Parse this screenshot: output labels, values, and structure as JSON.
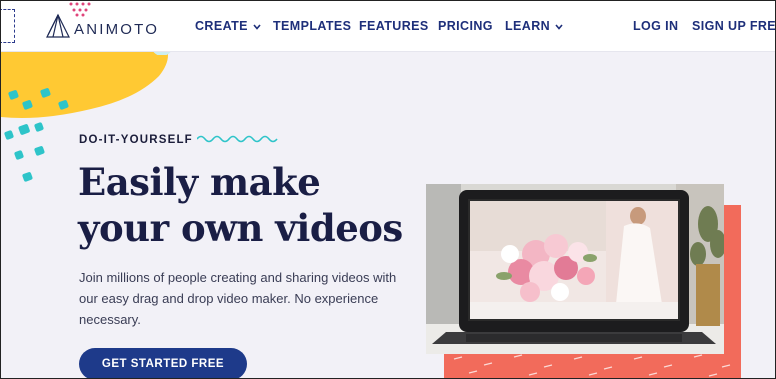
{
  "brand": {
    "name": "ANIMOTO"
  },
  "nav": {
    "items": [
      {
        "label": "CREATE",
        "has_dropdown": true
      },
      {
        "label": "TEMPLATES",
        "has_dropdown": false
      },
      {
        "label": "FEATURES",
        "has_dropdown": false
      },
      {
        "label": "PRICING",
        "has_dropdown": false
      },
      {
        "label": "LEARN",
        "has_dropdown": true
      }
    ],
    "login": "LOG IN",
    "signup": "SIGN UP FREE"
  },
  "hero": {
    "eyebrow": "DO-IT-YOURSELF",
    "headline_line1": "Easily make",
    "headline_line2": "your own videos",
    "subtext": "Join millions of people creating and sharing videos with our easy drag and drop video maker. No experience necessary.",
    "cta": "GET STARTED FREE"
  },
  "colors": {
    "nav_text": "#1e2f7a",
    "cta_bg": "#1e3a8a",
    "accent_coral": "#f26b5b",
    "accent_yellow": "#ffc933",
    "accent_teal": "#2ec4c9",
    "page_bg": "#f2f1f7"
  }
}
